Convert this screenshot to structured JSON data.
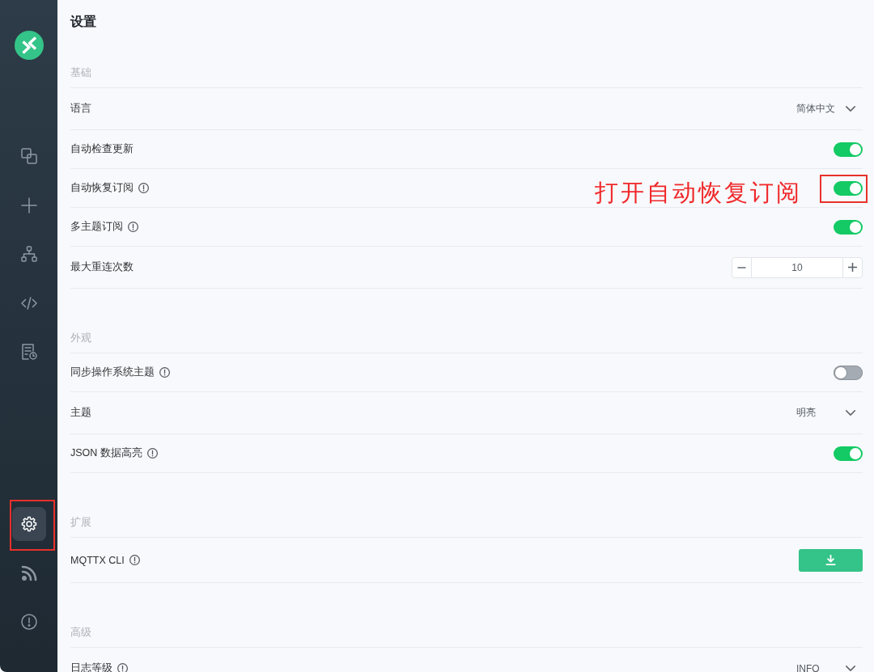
{
  "sidebar": {
    "main_items": [
      {
        "kind": "windows",
        "selected": false,
        "highlighted": false
      },
      {
        "kind": "plus",
        "selected": false,
        "highlighted": false
      },
      {
        "kind": "tree",
        "selected": false,
        "highlighted": false
      },
      {
        "kind": "code",
        "selected": false,
        "highlighted": false
      },
      {
        "kind": "log",
        "selected": false,
        "highlighted": false
      }
    ],
    "footer_items": [
      {
        "kind": "gear",
        "selected": true,
        "highlighted": true
      },
      {
        "kind": "feed",
        "selected": false,
        "highlighted": false
      },
      {
        "kind": "alert",
        "selected": false,
        "highlighted": false
      }
    ]
  },
  "page": {
    "title": "设置"
  },
  "sections": [
    {
      "title": "基础",
      "rows": [
        {
          "kind": "select",
          "label": "语言",
          "info": false,
          "value": "简体中文",
          "highlighted": false
        },
        {
          "kind": "toggle",
          "label": "自动检查更新",
          "info": false,
          "on": true,
          "highlighted": false
        },
        {
          "kind": "toggle",
          "label": "自动恢复订阅",
          "info": true,
          "on": true,
          "highlighted": true,
          "annotation": "打开自动恢复订阅"
        },
        {
          "kind": "toggle",
          "label": "多主题订阅",
          "info": true,
          "on": true,
          "highlighted": false
        },
        {
          "kind": "number",
          "label": "最大重连次数",
          "info": false,
          "value": "10",
          "highlighted": false
        }
      ]
    },
    {
      "title": "外观",
      "rows": [
        {
          "kind": "toggle",
          "label": "同步操作系统主题",
          "info": true,
          "on": false,
          "highlighted": false
        },
        {
          "kind": "select",
          "label": "主题",
          "info": false,
          "value": "明亮",
          "highlighted": false
        },
        {
          "kind": "toggle",
          "label": "JSON 数据高亮",
          "info": true,
          "on": true,
          "highlighted": false
        }
      ]
    },
    {
      "title": "扩展",
      "rows": [
        {
          "kind": "button",
          "label": "MQTTX CLI",
          "info": true,
          "highlighted": false
        }
      ]
    },
    {
      "title": "高级",
      "rows": [
        {
          "kind": "select",
          "label": "日志等级",
          "info": true,
          "value": "INFO",
          "highlighted": false
        }
      ]
    }
  ]
}
